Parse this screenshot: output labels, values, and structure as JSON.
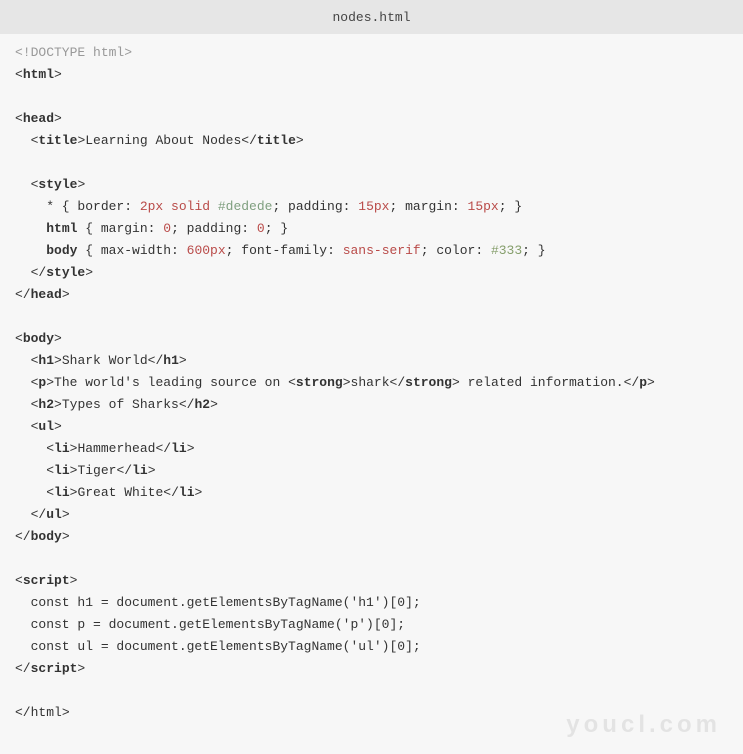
{
  "titlebar": {
    "filename": "nodes.html"
  },
  "watermark": "youcl.com",
  "code": {
    "doctype": "<!DOCTYPE html>",
    "tags": {
      "html": "html",
      "head": "head",
      "title": "title",
      "style": "style",
      "body": "body",
      "h1": "h1",
      "p": "p",
      "strong": "strong",
      "h2": "h2",
      "ul": "ul",
      "li": "li",
      "script": "script"
    },
    "title_text": "Learning About Nodes",
    "css": {
      "star_prefix": "    * { border: ",
      "star_border_width": "2px",
      "star_border_style": " solid ",
      "star_border_color": "#dedede",
      "star_mid": "; padding: ",
      "star_padding": "15px",
      "star_mid2": "; margin: ",
      "star_margin": "15px",
      "star_suffix": "; }",
      "html_prefix": "    ",
      "html_rule": " { margin: ",
      "html_margin": "0",
      "html_mid": "; padding: ",
      "html_padding": "0",
      "html_suffix": "; }",
      "body_prefix": "    ",
      "body_rule": " { max-width: ",
      "body_maxwidth": "600px",
      "body_mid": "; font-family: ",
      "body_fontfamily": "sans-serif",
      "body_mid2": "; color: ",
      "body_color": "#333",
      "body_suffix": "; }"
    },
    "content": {
      "h1_text": "Shark World",
      "p_start": "The world's leading source on ",
      "p_strong": "shark",
      "p_end": " related information.",
      "h2_text": "Types of Sharks",
      "li1": "Hammerhead",
      "li2": "Tiger",
      "li3": "Great White"
    },
    "script_lines": {
      "l1": "  const h1 = document.getElementsByTagName('h1')[0];",
      "l2": "  const p = document.getElementsByTagName('p')[0];",
      "l3": "  const ul = document.getElementsByTagName('ul')[0];"
    }
  }
}
